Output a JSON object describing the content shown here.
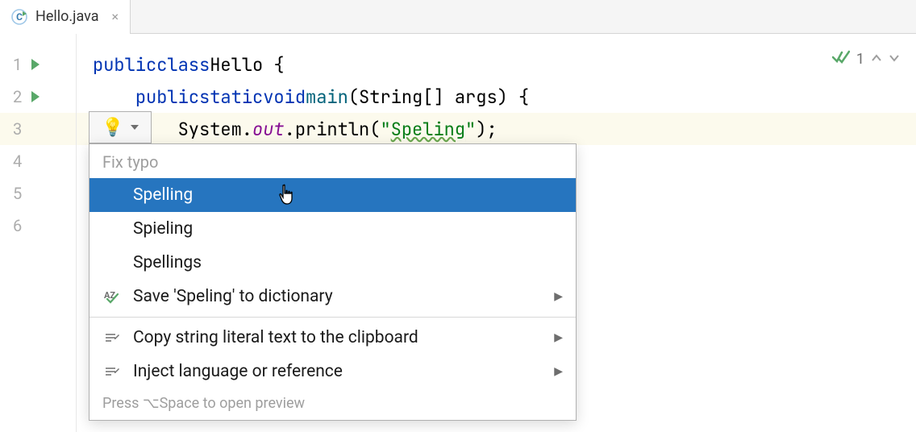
{
  "tab": {
    "filename": "Hello.java"
  },
  "gutter": {
    "lines": [
      "1",
      "2",
      "3",
      "4",
      "5",
      "6"
    ]
  },
  "code": {
    "l1": {
      "kw1": "public",
      "kw2": "class",
      "cls": "Hello",
      "brace": " {"
    },
    "l2": {
      "indent": "    ",
      "kw1": "public",
      "kw2": "static",
      "kw3": "void",
      "mth": "main",
      "params": "(String[] args) {"
    },
    "l3": {
      "indent": "        ",
      "sys": "System.",
      "out": "out",
      "dot": ".",
      "println": "println",
      "open": "(",
      "q1": "\"",
      "typo": "Speling",
      "q2": "\"",
      "close": ");"
    }
  },
  "inspection": {
    "count": "1"
  },
  "popup": {
    "header": "Fix typo",
    "items": {
      "spelling": "Spelling",
      "spieling": "Spieling",
      "spellings": "Spellings",
      "save_dict": "Save 'Speling' to dictionary",
      "copy_literal": "Copy string literal text to the clipboard",
      "inject_lang": "Inject language or reference"
    },
    "footer": "Press ⌥Space to open preview"
  }
}
